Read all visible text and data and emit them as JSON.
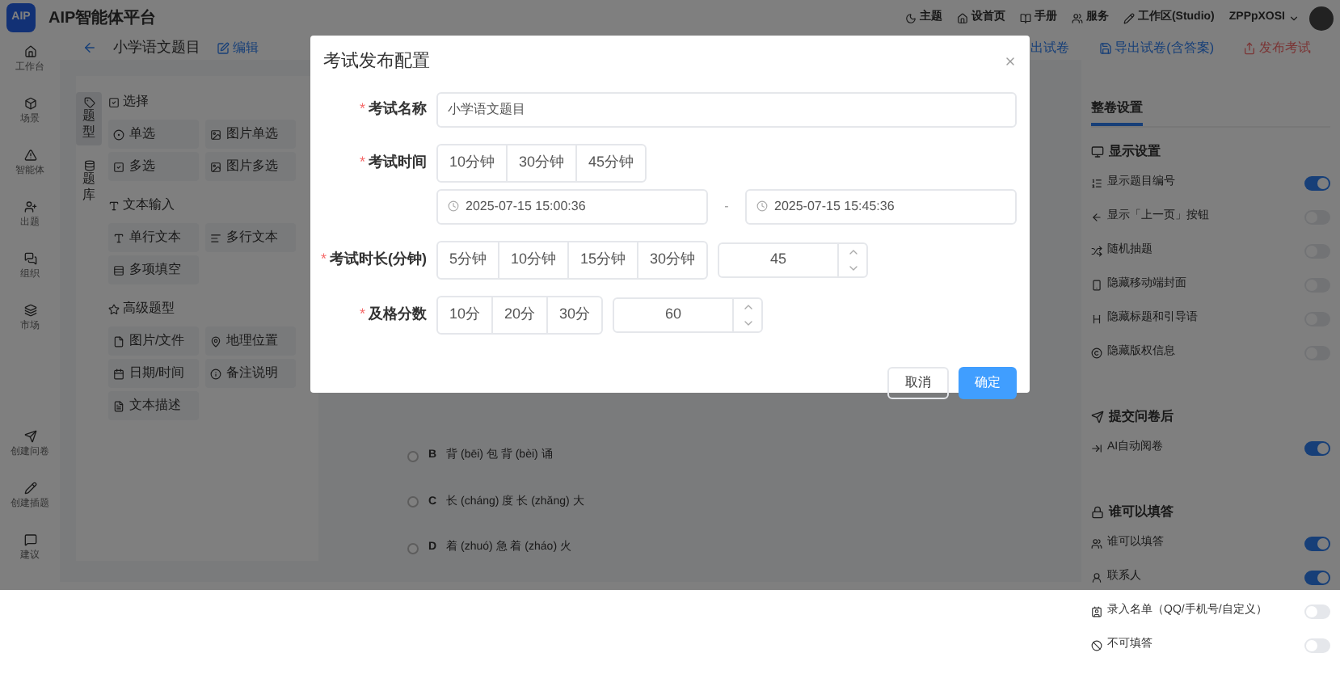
{
  "app": {
    "logo": "AIP",
    "title": "AIP智能体平台"
  },
  "top_links": [
    {
      "label": "主题"
    },
    {
      "label": "设首页"
    },
    {
      "label": "手册"
    },
    {
      "label": "服务"
    },
    {
      "label": "工作区(Studio)"
    }
  ],
  "user": {
    "name": "ZPPpXOSI"
  },
  "sidebar": {
    "items": [
      {
        "label": "工作台"
      },
      {
        "label": "场景"
      },
      {
        "label": "智能体"
      },
      {
        "label": "出题"
      },
      {
        "label": "组织"
      },
      {
        "label": "市场"
      }
    ],
    "bottom_items": [
      {
        "label": "创建问卷"
      },
      {
        "label": "创建插题"
      },
      {
        "label": "建议"
      }
    ]
  },
  "header": {
    "title": "小学语文题目",
    "edit": "编辑",
    "actions": [
      {
        "label": "出试卷",
        "kind": "plain"
      },
      {
        "label": "导出试卷(含答案)",
        "kind": "save"
      },
      {
        "label": "发布考试",
        "kind": "danger"
      }
    ]
  },
  "panel_tabs": [
    {
      "label": "题型",
      "selected": true
    },
    {
      "label": "题库",
      "selected": false
    }
  ],
  "question_groups": [
    {
      "title": "选择",
      "items": [
        "单选",
        "图片单选",
        "多选",
        "图片多选"
      ]
    },
    {
      "title": "文本输入",
      "items": [
        "单行文本",
        "多行文本",
        "多项填空"
      ]
    },
    {
      "title": "高级题型",
      "items": [
        "图片/文件",
        "地理位置",
        "日期/时间",
        "备注说明",
        "文本描述"
      ]
    }
  ],
  "options": [
    {
      "letter": "B",
      "text": "背 (bēi) 包 背 (bèi) 诵",
      "selected": false
    },
    {
      "letter": "C",
      "text": "长 (cháng) 度 长 (zhǎng) 大",
      "selected": false
    },
    {
      "letter": "D",
      "text": "着 (zhuó) 急 着 (zháo) 火",
      "selected": false
    }
  ],
  "settings": {
    "tab": "整卷设置",
    "sections": [
      {
        "title": "显示设置",
        "rows": [
          {
            "label": "显示题目编号",
            "on": true
          },
          {
            "label": "显示「上一页」按钮",
            "on": false
          },
          {
            "label": "随机抽题",
            "on": false
          },
          {
            "label": "隐藏移动端封面",
            "on": false
          },
          {
            "label": "隐藏标题和引导语",
            "on": false
          },
          {
            "label": "隐藏版权信息",
            "on": false
          }
        ]
      },
      {
        "title": "提交问卷后",
        "rows": [
          {
            "label": "AI自动阅卷",
            "on": true
          }
        ]
      },
      {
        "title": "谁可以填答",
        "rows": [
          {
            "label": "谁可以填答",
            "on": true
          },
          {
            "label": "联系人",
            "on": true
          },
          {
            "label": "录入名单（QQ/手机号/自定义）",
            "on": false
          },
          {
            "label": "不可填答",
            "on": false
          }
        ]
      }
    ]
  },
  "dialog": {
    "title": "考试发布配置",
    "name_mark": "*",
    "name_label": "考试名称",
    "name_value": "小学语文题目",
    "time_mark": "*",
    "time_label": "考试时间",
    "time_presets": [
      "10分钟",
      "30分钟",
      "45分钟"
    ],
    "start": "2025-07-15 15:00:36",
    "separator": "-",
    "end": "2025-07-15 15:45:36",
    "duration_mark": "*",
    "duration_label": "考试时长(分钟)",
    "duration_presets": [
      "5分钟",
      "10分钟",
      "15分钟",
      "30分钟"
    ],
    "duration_value": "45",
    "pass_mark": "*",
    "pass_label": "及格分数",
    "pass_presets": [
      "10分",
      "20分",
      "30分"
    ],
    "pass_value": "60",
    "cancel": "取消",
    "ok": "确定"
  }
}
